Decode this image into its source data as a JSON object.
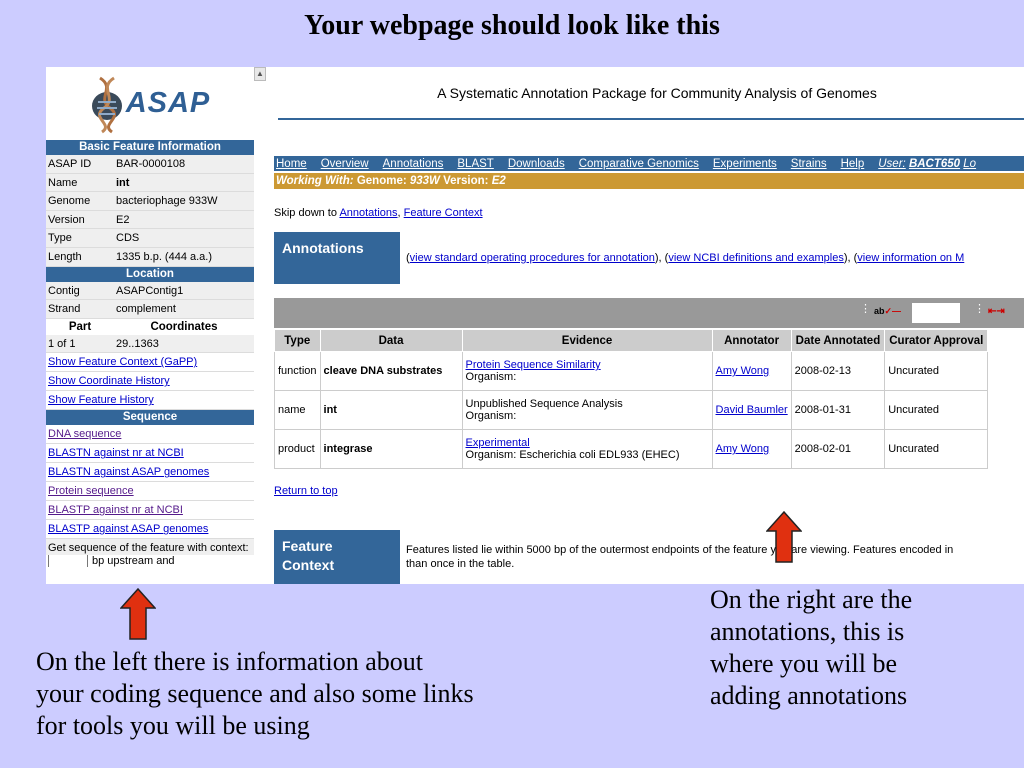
{
  "slide": {
    "title": "Your webpage should look like this",
    "left_note_lines": [
      "On the left there is information about",
      "your coding sequence and also some links",
      "for tools you will be using"
    ],
    "right_note_lines": [
      "On the right are the",
      "annotations, this is",
      "where you will be",
      "adding annotations"
    ],
    "arrow_color": "#e03010"
  },
  "left": {
    "logo_text": "ASAP",
    "basic_header": "Basic Feature Information",
    "basic_rows": [
      {
        "k": "ASAP ID",
        "v": "BAR-0000108"
      },
      {
        "k": "Name",
        "v": "int"
      },
      {
        "k": "Genome",
        "v": "bacteriophage 933W"
      },
      {
        "k": "Version",
        "v": "E2"
      },
      {
        "k": "Type",
        "v": "CDS"
      },
      {
        "k": "Length",
        "v": "1335 b.p. (444 a.a.)"
      }
    ],
    "location_header": "Location",
    "location_rows": [
      {
        "k": "Contig",
        "v": "ASAPContig1"
      },
      {
        "k": "Strand",
        "v": "complement"
      }
    ],
    "part_label": "Part",
    "coord_label": "Coordinates",
    "part_row": {
      "k": "1 of 1",
      "v": "29..1363"
    },
    "feature_links": [
      "Show Feature Context (GaPP)",
      "Show Coordinate History",
      "Show Feature History"
    ],
    "sequence_header": "Sequence",
    "sequence_links": [
      "DNA sequence",
      "BLASTN against nr at NCBI",
      "BLASTN against ASAP genomes",
      "Protein sequence",
      "BLASTP against nr at NCBI",
      "BLASTP against ASAP genomes"
    ],
    "context_text": "Get sequence of the feature with context:",
    "context_partial": "bp upstream and"
  },
  "right": {
    "app_title": "A Systematic Annotation Package for Community Analysis of Genomes",
    "menu": [
      "Home",
      "Overview",
      "Annotations",
      "BLAST",
      "Downloads",
      "Comparative Genomics",
      "Experiments",
      "Strains",
      "Help"
    ],
    "user_label": "User:",
    "user_name": "BACT650",
    "logout": "Lo",
    "working_label": "Working With:",
    "working_genome_label": "Genome:",
    "working_genome": "933W",
    "working_version_label": "Version:",
    "working_version": "E2",
    "skip_text": "Skip down to",
    "skip_links": [
      "Annotations",
      "Feature Context"
    ],
    "annotations_header": "Annotations",
    "ann_links": [
      "view standard operating procedures for annotation",
      "view NCBI definitions and examples",
      "view information on M"
    ],
    "toolbar_glyph": "ab",
    "table_headers": [
      "Type",
      "Data",
      "Evidence",
      "Annotator",
      "Date Annotated",
      "Curator Approval"
    ],
    "rows": [
      {
        "type": "function",
        "data": "cleave DNA substrates",
        "evidence": "Protein Sequence Similarity",
        "evidence_link": true,
        "organism": "Organism:",
        "annotator": "Amy Wong",
        "date": "2008-02-13",
        "approval": "Uncurated"
      },
      {
        "type": "name",
        "data": "int",
        "evidence": "Unpublished Sequence Analysis",
        "evidence_link": false,
        "organism": "Organism:",
        "annotator": "David Baumler",
        "date": "2008-01-31",
        "approval": "Uncurated"
      },
      {
        "type": "product",
        "data": "integrase",
        "evidence": "Experimental",
        "evidence_link": true,
        "organism": "Organism: Escherichia coli EDL933 (EHEC)",
        "annotator": "Amy Wong",
        "date": "2008-02-01",
        "approval": "Uncurated"
      }
    ],
    "return_top": "Return to top",
    "fc_header_line1": "Feature",
    "fc_header_line2": "Context",
    "fc_text_line1": "Features listed lie within 5000 bp of the outermost endpoints of the feature you are viewing. Features encoded in",
    "fc_text_line2": "than once in the table."
  }
}
